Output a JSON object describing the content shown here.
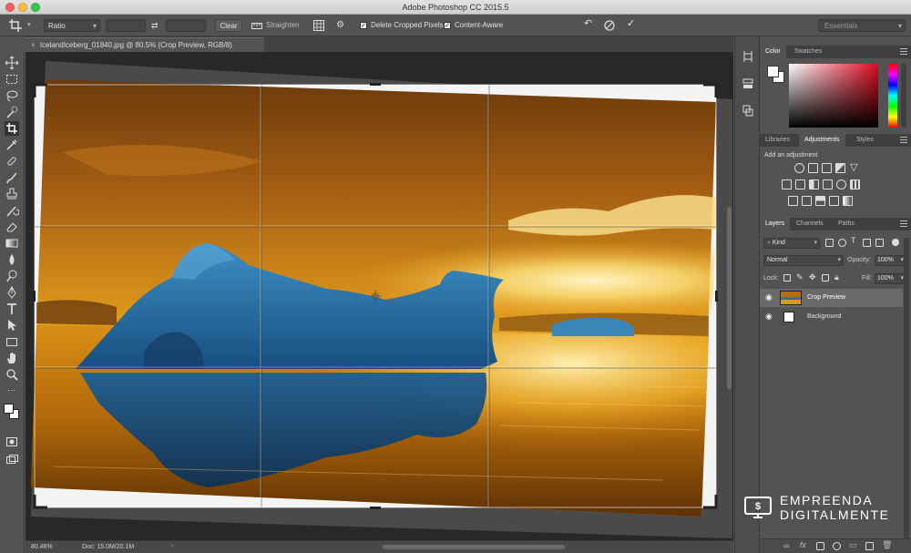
{
  "window": {
    "title": "Adobe Photoshop CC 2015.5"
  },
  "options_bar": {
    "ratio_label": "Ratio",
    "clear_label": "Clear",
    "straighten_label": "Straighten",
    "delete_cropped_label": "Delete Cropped Pixels",
    "content_aware_label": "Content-Aware",
    "workspace": "Essentials",
    "delete_cropped_checked": true,
    "content_aware_checked": true
  },
  "document": {
    "tab_title": "IcelandIceberg_01840.jpg @ 80.5% (Crop Preview, RGB/8)"
  },
  "status": {
    "zoom": "80.46%",
    "doc_info": "Doc: 15.0M/20.1M"
  },
  "color_panel": {
    "tabs": [
      "Color",
      "Swatches"
    ],
    "active": "Color"
  },
  "adjustments_panel": {
    "tabs": [
      "Libraries",
      "Adjustments",
      "Styles"
    ],
    "active": "Adjustments",
    "heading": "Add an adjustment"
  },
  "layers_panel": {
    "tabs": [
      "Layers",
      "Channels",
      "Paths"
    ],
    "active": "Layers",
    "filter_kind": "Kind",
    "blend_mode": "Normal",
    "opacity_label": "Opacity:",
    "opacity_value": "100%",
    "lock_label": "Lock:",
    "fill_label": "Fill:",
    "fill_value": "100%",
    "layers": [
      {
        "name": "Crop Preview",
        "selected": true
      },
      {
        "name": "Background",
        "selected": false
      }
    ]
  },
  "watermark": {
    "line1": "EMPREENDA",
    "line2": "DIGITALMENTE"
  },
  "colors": {
    "ui_bg": "#535353",
    "panel_dark": "#3f3f3f",
    "selection": "#6a6a6a"
  }
}
